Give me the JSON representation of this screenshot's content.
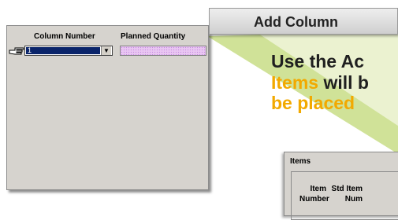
{
  "panel": {
    "column_number_header": "Column Number",
    "planned_quantity_header": "Planned Quantity",
    "column_number_value": "1",
    "dropdown_arrow": "▼",
    "pointer_icon": "hand-pointer-icon"
  },
  "callout": {
    "add_column_label": "Add Column",
    "line1": "Use the Ac",
    "line2_highlight": "Items",
    "line2_rest": " will b",
    "line3": "be placed"
  },
  "items_panel": {
    "title": "Items",
    "col1_line1": "Item",
    "col1_line2": "Number",
    "col2_line1": "Std Item",
    "col2_line2": "Num"
  },
  "colors": {
    "highlight": "#f2a900",
    "beam": "#c8dd86",
    "panel_bg": "#d6d3ce",
    "selection": "#0a246a"
  }
}
